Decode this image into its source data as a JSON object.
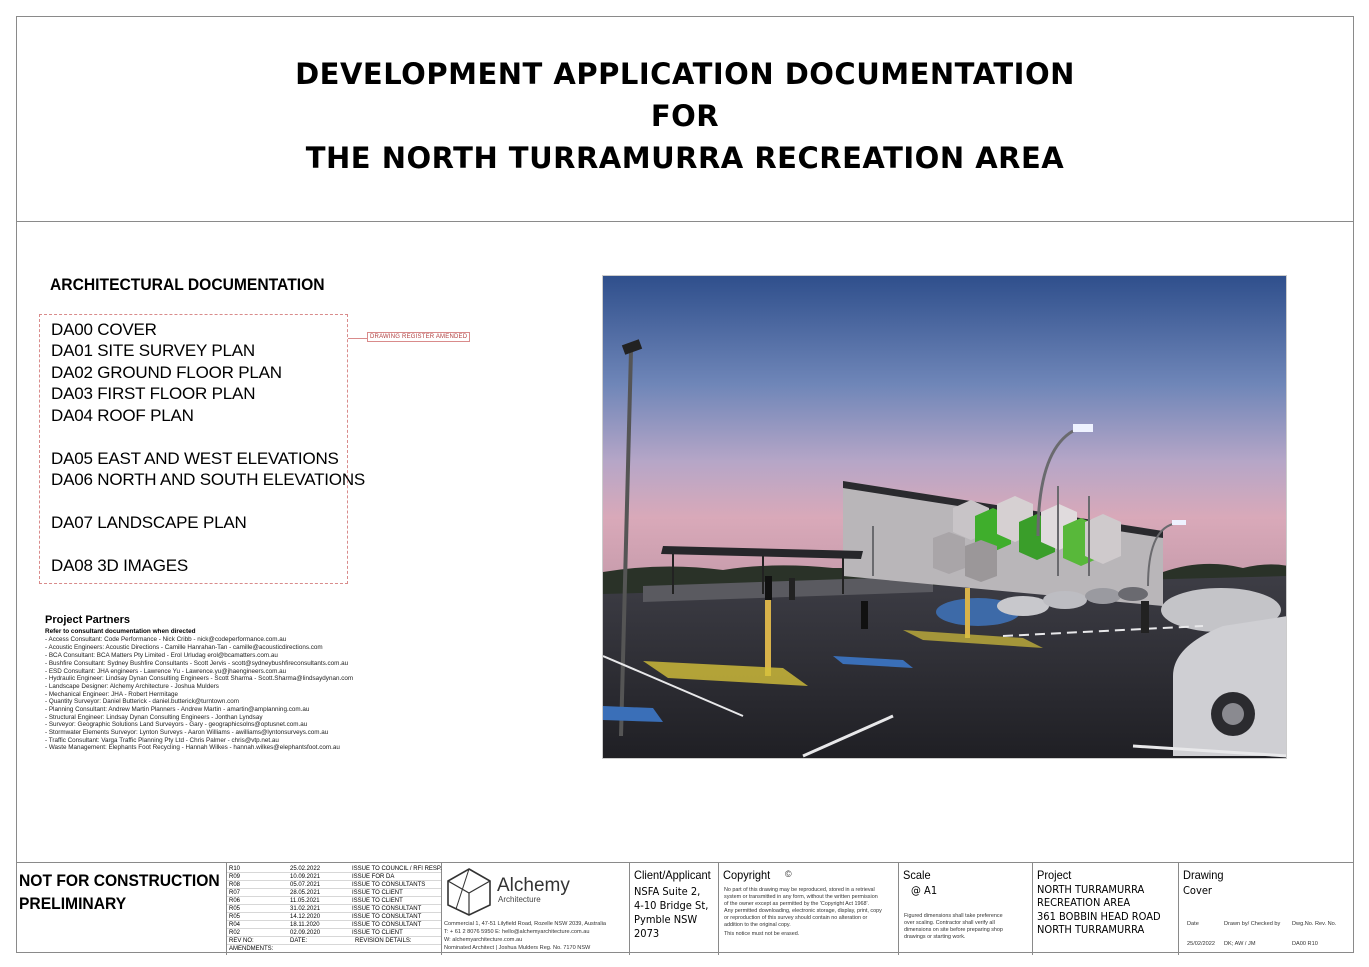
{
  "header": {
    "title_lines": [
      "DEVELOPMENT APPLICATION DOCUMENTATION",
      "FOR",
      "THE NORTH TURRAMURRA RECREATION AREA"
    ]
  },
  "architectural": {
    "heading": "ARCHITECTURAL DOCUMENTATION",
    "drawings": [
      "DA00 COVER",
      "DA01 SITE SURVEY PLAN",
      "DA02 GROUND FLOOR PLAN",
      "DA03 FIRST FLOOR PLAN",
      "DA04 ROOF PLAN",
      "DA05 EAST AND WEST ELEVATIONS",
      "DA06 NORTH AND SOUTH ELEVATIONS",
      "DA07 LANDSCAPE PLAN",
      "DA08 3D IMAGES"
    ],
    "revision_note": "DRAWING REGISTER AMENDED"
  },
  "partners": {
    "heading": "Project Partners",
    "note": "Refer to consultant documentation when directed",
    "lines": [
      "- Access Consultant: Code Performance - Nick Cribb - nick@codeperformance.com.au",
      "- Acoustic Engineers: Acoustic Directions - Camille Hanrahan-Tan - camille@acousticdirections.com",
      "- BCA Consultant: BCA Matters Pty Limited - Erol Urludag erol@bcamatters.com.au",
      "- Bushfire Consultant: Sydney Bushfire Consultants - Scott Jervis - scott@sydneybushfireconsultants.com.au",
      "- ESD Consultant: JHA engineers - Lawrence Yu - Lawrence.yu@jhaengineers.com.au",
      "- Hydraulic Engineer: Lindsay Dynan Consulting Engineers - Scott Sharma - Scott.Sharma@lindsaydynan.com",
      "- Landscape Designer: Alchemy Architecture - Joshua Mulders",
      "- Mechanical Engineer: JHA - Robert Hermitage",
      "- Quantity Surveyor: Daniel Butterick - daniel.butterick@turntown.com",
      "- Planning Consultant: Andrew Martin Planners - Andrew Martin - amartin@amplanning.com.au",
      "- Structural Engineer: Lindsay Dynan Consulting Engineers - Jonthan Lyndsay",
      "- Surveyor: Geographic Solutions Land Surveyors - Gary - geographicsolns@optusnet.com.au",
      "- Stormwater Elements Surveyor: Lynton Surveys - Aaron Williams - awilliams@lyntonsurveys.com.au",
      "- Traffic Consultant: Varga Traffic Planning Pty Ltd - Chris Palmer - chris@vtp.net.au",
      "- Waste Management: Elephants Foot Recycling - Hannah Wilkes - hannah.wilkes@elephantsfoot.com.au"
    ]
  },
  "title_block": {
    "status_lines": [
      "NOT FOR CONSTRUCTION",
      "PRELIMINARY"
    ],
    "revisions": [
      {
        "rev": "R10",
        "date": "25.02.2022",
        "details": "ISSUE TO COUNCIL / RFI RESP."
      },
      {
        "rev": "R09",
        "date": "10.09.2021",
        "details": "ISSUE FOR DA"
      },
      {
        "rev": "R08",
        "date": "05.07.2021",
        "details": "ISSUE TO CONSULTANTS"
      },
      {
        "rev": "R07",
        "date": "28.05.2021",
        "details": "ISSUE TO CLIENT"
      },
      {
        "rev": "R06",
        "date": "11.05.2021",
        "details": "ISSUE TO CLIENT"
      },
      {
        "rev": "R05",
        "date": "31.02.2021",
        "details": "ISSUE TO CONSULTANT"
      },
      {
        "rev": "R05",
        "date": "14.12.2020",
        "details": "ISSUE TO CONSULTANT"
      },
      {
        "rev": "R04",
        "date": "18.11.2020",
        "details": "ISSUE TO CONSULTANT"
      },
      {
        "rev": "R02",
        "date": "02.09.2020",
        "details": "ISSUE TO CLIENT"
      }
    ],
    "rev_headers": {
      "rev": "REV NO:",
      "date": "DATE:",
      "details": "REVISION DETAILS:"
    },
    "amendments_label": "AMENDMENTS:",
    "firm": {
      "name": "Alchemy",
      "sub": "Architecture",
      "lines": [
        "Commercial 1, 47-51 Lilyfield Road, Rozelle NSW 2039, Australia",
        "T: + 61 2 8076 5950 E: hello@alchemyarchitecture.com.au",
        "W: alchemyarchitecture.com.au",
        "Nominated Architect | Joshua Mulders Reg. No. 7170 NSW"
      ]
    },
    "client": {
      "title": "Client/Applicant",
      "lines": [
        "NSFA Suite 2,",
        "4-10 Bridge St,",
        "Pymble NSW",
        "2073"
      ]
    },
    "copyright": {
      "title": "Copyright",
      "symbol": "©",
      "lines": [
        "No part of this drawing may be reproduced, stored in a retrieval",
        "system or transmitted in any form, without the written permission",
        "of the owner except as permitted by the 'Copyright Act 1968'.",
        "Any permitted downloading, electronic storage, display, print, copy",
        "or reproduction of this survey should contain no alteration or",
        "addition to the original copy.",
        "This notice must not be erased."
      ]
    },
    "scale": {
      "title": "Scale",
      "value": "@ A1",
      "lines": [
        "Figured dimensions shall take preference",
        "over scaling.  Contractor shall verify all",
        "dimensions on site before preparing shop",
        "drawings or starting work."
      ]
    },
    "project": {
      "title": "Project",
      "lines": [
        "NORTH TURRAMURRA",
        "RECREATION AREA",
        "361 BOBBIN HEAD ROAD",
        "NORTH TURRAMURRA"
      ]
    },
    "drawing": {
      "title": "Drawing",
      "value": "Cover",
      "date_label": "Date",
      "drawn_label": "Drawn by/ Checked by",
      "dwg_label": "Dwg.No. Rev. No.",
      "date": "25/02/2022",
      "drawn": "DK; AW / JM",
      "dwg": "DA00 R10"
    }
  }
}
